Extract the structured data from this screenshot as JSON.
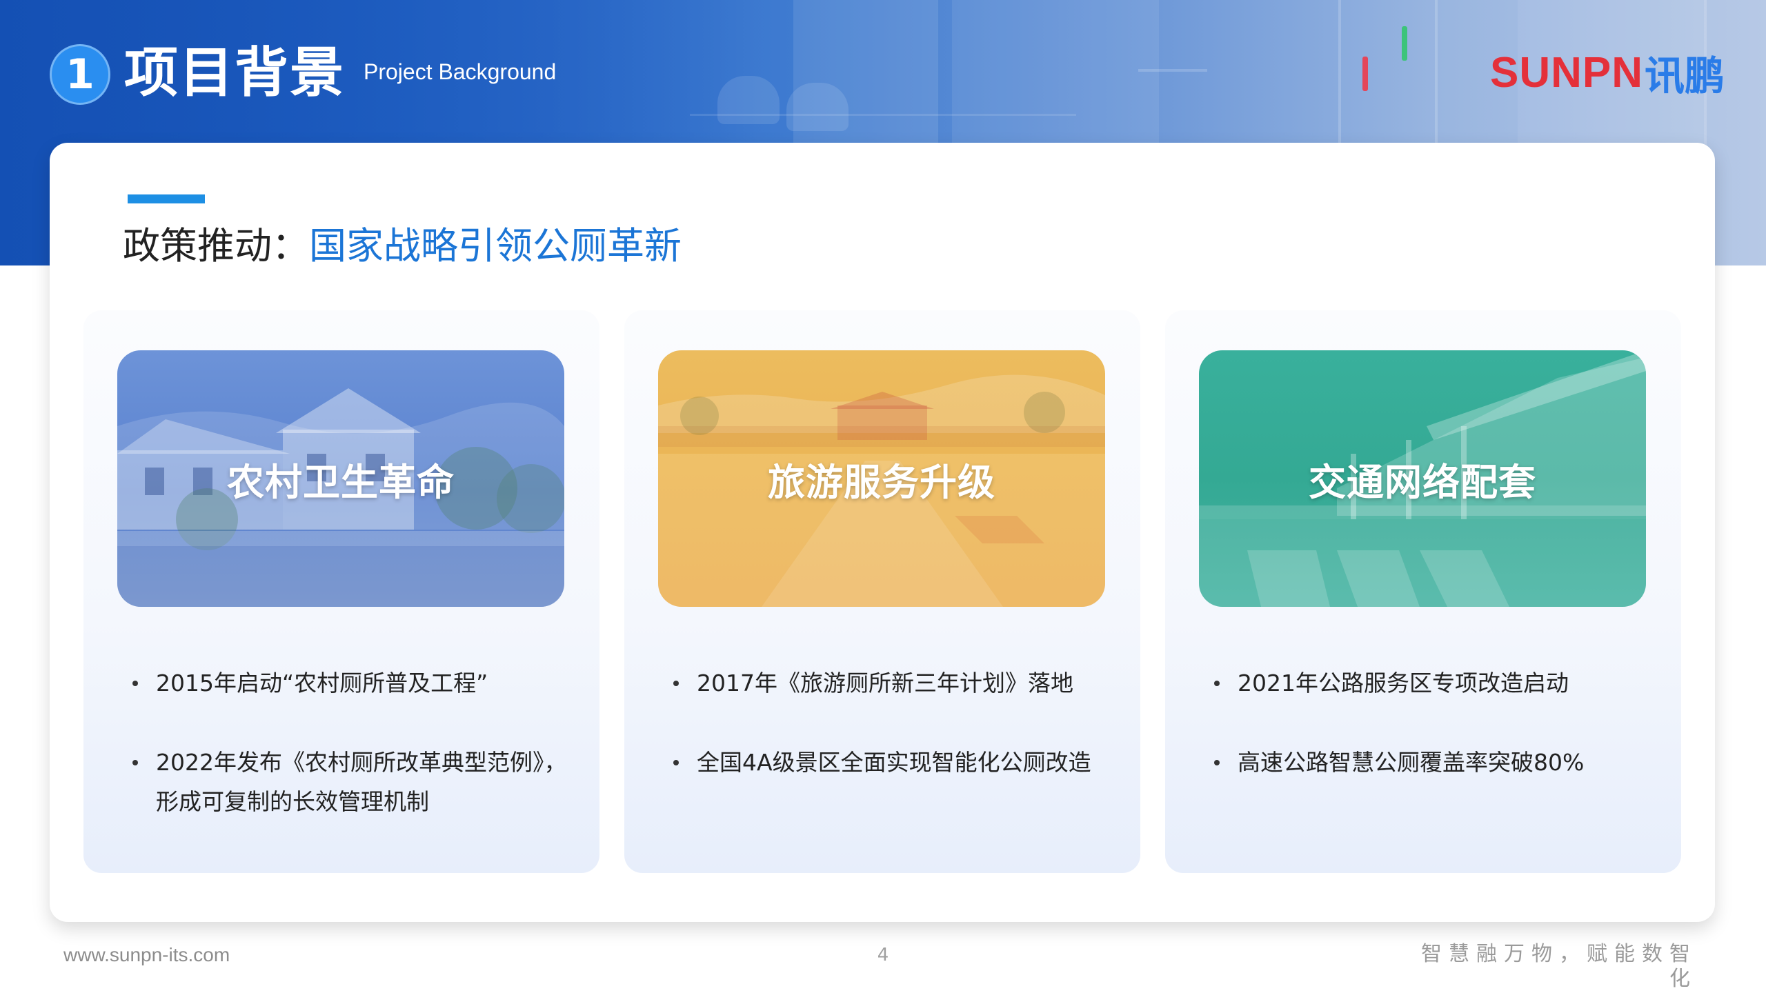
{
  "header": {
    "section_number": "1",
    "section_title": "项目背景",
    "section_subtitle": "Project Background",
    "logo": {
      "en": "SUNPN",
      "cn": "讯鹏"
    }
  },
  "policy": {
    "heading_prefix": "政策推动：",
    "heading_highlight": "国家战略引领公厕革新"
  },
  "columns": [
    {
      "caption": "农村卫生革命",
      "bullets": [
        "2015年启动“农村厕所普及工程”",
        "2022年发布《农村厕所改革典型范例》，形成可复制的长效管理机制"
      ]
    },
    {
      "caption": "旅游服务升级",
      "bullets": [
        "2017年《旅游厕所新三年计划》落地",
        "全国4A级景区全面实现智能化公厕改造"
      ]
    },
    {
      "caption": "交通网络配套",
      "bullets": [
        "2021年公路服务区专项改造启动",
        "高速公路智慧公厕覆盖率突破80%"
      ]
    }
  ],
  "footer": {
    "url": "www.sunpn-its.com",
    "page_number": "4",
    "slogan": "智慧融万物，赋能数智化"
  },
  "colors": {
    "brand_blue": "#1b75d6",
    "accent_blue": "#1d8fe4",
    "logo_red": "#e4303a",
    "logo_blue": "#2a7ce8",
    "rural_overlay": "#4f79c9",
    "tourism_overlay": "#e9b04b",
    "transport_overlay": "#2eab97"
  }
}
